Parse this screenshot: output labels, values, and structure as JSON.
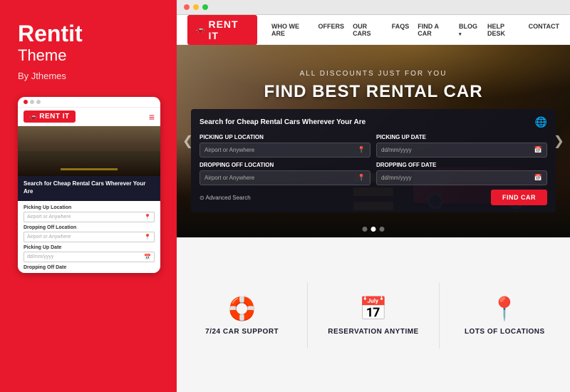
{
  "left": {
    "brand": "Rentit",
    "theme": "Theme",
    "by": "By Jthemes"
  },
  "mobile": {
    "dots": [
      "dot1",
      "dot2",
      "dot3"
    ],
    "logo_text": "RENT IT",
    "hamburger": "≡",
    "search_title": "Search for Cheap Rental Cars Wherever Your Are",
    "fields": [
      {
        "label": "Picking Up Location",
        "placeholder": "Airport or Anywhere"
      },
      {
        "label": "Dropping Off Location",
        "placeholder": "Airport or Anywhere"
      },
      {
        "label": "Picking Up Date",
        "placeholder": "dd/mm/yyyy"
      }
    ],
    "dropping_off_date_label": "Dropping Off Date"
  },
  "browser": {
    "dots": [
      "red",
      "yellow",
      "green"
    ]
  },
  "nav": {
    "logo_text": "RENT IT",
    "links": [
      {
        "label": "WHO WE ARE",
        "arrow": false
      },
      {
        "label": "OFFERS",
        "arrow": false
      },
      {
        "label": "OUR CARS",
        "arrow": false
      },
      {
        "label": "FAQS",
        "arrow": false
      },
      {
        "label": "FIND A CAR",
        "arrow": false
      },
      {
        "label": "BLOG",
        "arrow": true
      },
      {
        "label": "HELP DESK",
        "arrow": false
      },
      {
        "label": "CONTACT",
        "arrow": false
      }
    ]
  },
  "hero": {
    "subtitle": "ALL DISCOUNTS JUST FOR YOU",
    "title": "FIND BEST RENTAL CAR",
    "search_box_title": "Search for Cheap Rental Cars Wherever Your Are",
    "fields": {
      "pickup_location": {
        "label": "Picking Up Location",
        "placeholder": "Airport or Anywhere"
      },
      "pickup_date": {
        "label": "Picking Up Date",
        "placeholder": "dd/mm/yyyy"
      },
      "dropoff_location": {
        "label": "Dropping Off Location",
        "placeholder": "Airport or Anywhere"
      },
      "dropoff_date": {
        "label": "Dropping Off Date",
        "placeholder": "dd/mm/yyyy"
      }
    },
    "advanced_search": "⊙ Advanced Search",
    "find_car_btn": "FIND CAR",
    "dots": [
      1,
      2,
      3
    ],
    "prev_arrow": "❮",
    "next_arrow": "❯"
  },
  "features": [
    {
      "icon": "🛟",
      "label": "7/24 CAR SUPPORT"
    },
    {
      "icon": "📅",
      "label": "RESERVATION ANYTIME"
    },
    {
      "icon": "📍",
      "label": "LOTS OF LOCATIONS"
    }
  ]
}
